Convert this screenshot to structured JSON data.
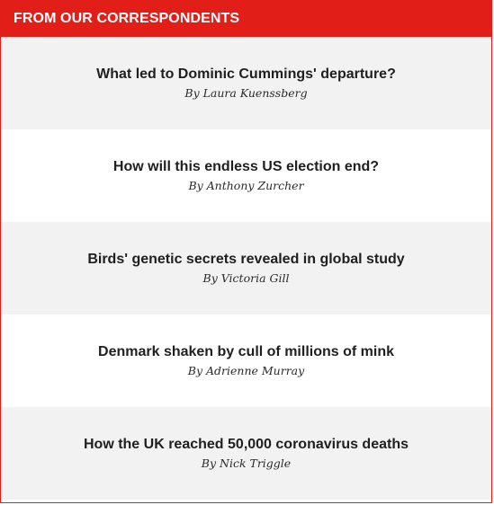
{
  "header": {
    "title": "FROM OUR CORRESPONDENTS"
  },
  "stories": [
    {
      "title": "What led to Dominic Cummings' departure?",
      "byline": "By Laura Kuenssberg"
    },
    {
      "title": "How will this endless US election end?",
      "byline": "By Anthony Zurcher"
    },
    {
      "title": "Birds' genetic secrets revealed in global study",
      "byline": "By Victoria Gill"
    },
    {
      "title": "Denmark shaken by cull of millions of mink",
      "byline": "By Adrienne Murray"
    },
    {
      "title": "How the UK reached 50,000 coronavirus deaths",
      "byline": "By Nick Triggle"
    }
  ],
  "colors": {
    "accent": "#e11f18",
    "alt_row": "#f2f2f2",
    "text": "#1f1f1f"
  }
}
